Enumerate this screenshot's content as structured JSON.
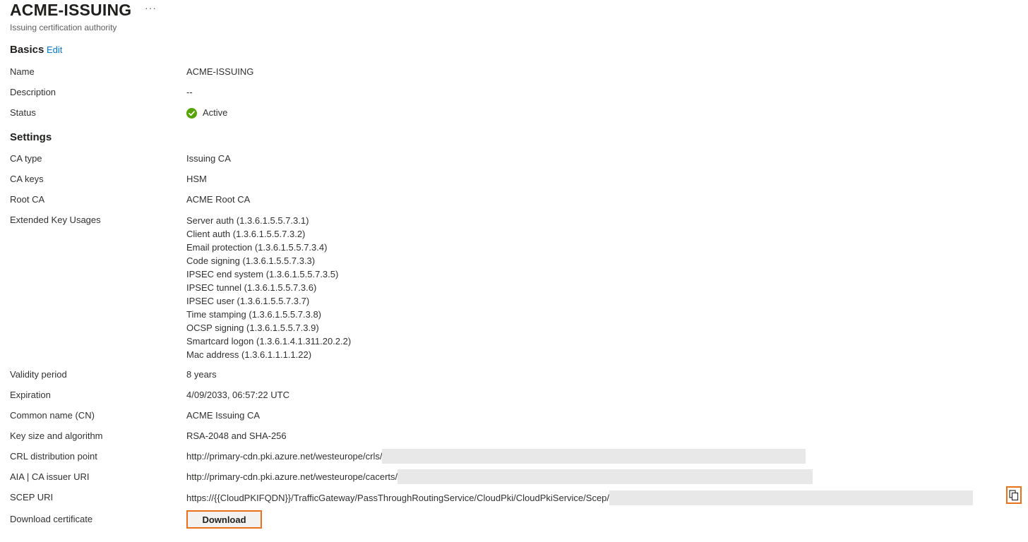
{
  "header": {
    "title": "ACME-ISSUING",
    "more_label": "···",
    "subtitle": "Issuing certification authority"
  },
  "basics": {
    "heading": "Basics",
    "edit_label": "Edit",
    "name_label": "Name",
    "name_value": "ACME-ISSUING",
    "description_label": "Description",
    "description_value": "--",
    "status_label": "Status",
    "status_value": "Active",
    "status_icon": "check-circle-icon",
    "status_color": "#57a300"
  },
  "settings": {
    "heading": "Settings",
    "ca_type_label": "CA type",
    "ca_type_value": "Issuing CA",
    "ca_keys_label": "CA keys",
    "ca_keys_value": "HSM",
    "root_ca_label": "Root CA",
    "root_ca_value": "ACME Root CA",
    "eku_label": "Extended Key Usages",
    "eku_values": [
      "Server auth (1.3.6.1.5.5.7.3.1)",
      "Client auth (1.3.6.1.5.5.7.3.2)",
      "Email protection (1.3.6.1.5.5.7.3.4)",
      "Code signing (1.3.6.1.5.5.7.3.3)",
      "IPSEC end system (1.3.6.1.5.5.7.3.5)",
      "IPSEC tunnel (1.3.6.1.5.5.7.3.6)",
      "IPSEC user (1.3.6.1.5.5.7.3.7)",
      "Time stamping (1.3.6.1.5.5.7.3.8)",
      "OCSP signing (1.3.6.1.5.5.7.3.9)",
      "Smartcard logon (1.3.6.1.4.1.311.20.2.2)",
      "Mac address (1.3.6.1.1.1.1.22)"
    ],
    "validity_label": "Validity period",
    "validity_value": "8 years",
    "expiration_label": "Expiration",
    "expiration_value": "4/09/2033, 06:57:22 UTC",
    "cn_label": "Common name (CN)",
    "cn_value": "ACME Issuing CA",
    "key_label": "Key size and algorithm",
    "key_value": "RSA-2048 and SHA-256",
    "crl_label": "CRL distribution point",
    "crl_value": "http://primary-cdn.pki.azure.net/westeurope/crls/",
    "aia_label": "AIA | CA issuer URI",
    "aia_value": "http://primary-cdn.pki.azure.net/westeurope/cacerts/",
    "scep_label": "SCEP URI",
    "scep_value": "https://{{CloudPKIFQDN}}/TrafficGateway/PassThroughRoutingService/CloudPki/CloudPkiService/Scep/",
    "copy_icon": "copy-icon",
    "download_label": "Download certificate",
    "download_button": "Download"
  },
  "colors": {
    "accent": "#0078d4",
    "highlight": "#e8711a",
    "redaction": "#e8e8e8"
  }
}
